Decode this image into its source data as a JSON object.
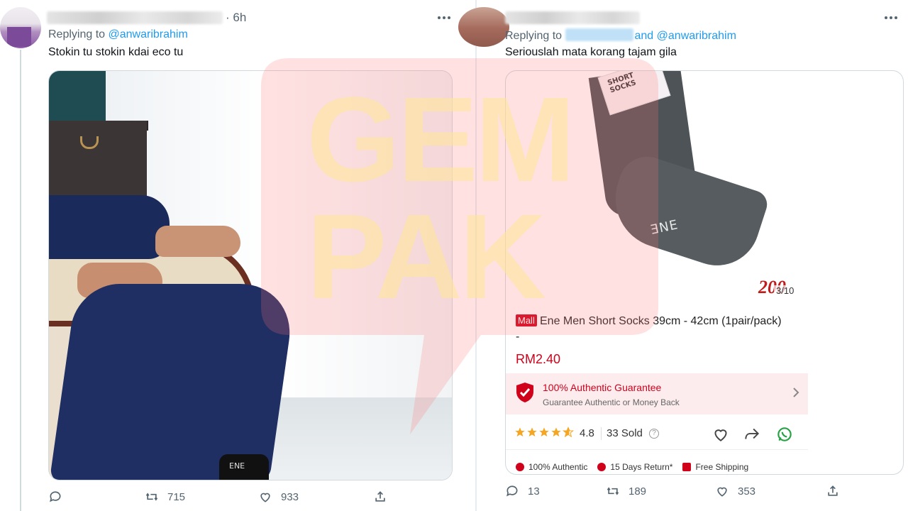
{
  "left_tweet": {
    "time": "6h",
    "replying_label": "Replying to",
    "replying_to": "@anwaribrahim",
    "text": "Stokin tu stokin kdai eco tu",
    "photo": {
      "shoe_label": "ENE"
    },
    "actions": {
      "reply_count": "",
      "retweet_count": "715",
      "like_count": "933"
    }
  },
  "right_tweet": {
    "replying_label": "Replying to",
    "replying_and": "and",
    "replying_to": "@anwaribrahim",
    "text": "Seriouslah mata korang tajam gila",
    "product": {
      "tag_text": "SHORT SOCKS",
      "sock_brand": "ƎNE",
      "badge": "200",
      "image_counter": "3/10",
      "mall_tag": "Mall",
      "title": "Ene Men Short Socks 39cm - 42cm (1pair/pack)",
      "title_continuation": "-",
      "price": "RM2.40",
      "guarantee_title": "100% Authentic Guarantee",
      "guarantee_subtitle": "Guarantee Authentic or Money Back",
      "rating": "4.8",
      "sold": "33 Sold",
      "stars_full": 4,
      "stars_half": 1,
      "perks": [
        "100% Authentic",
        "15 Days Return*",
        "Free Shipping"
      ]
    },
    "actions": {
      "reply_count": "13",
      "retweet_count": "189",
      "like_count": "353"
    }
  },
  "watermark": {
    "line1": "GEM",
    "line2": "PAK"
  },
  "colors": {
    "accent": "#1d9bf0",
    "muted": "#536471",
    "shopee_red": "#d0011b",
    "star": "#f5a623"
  }
}
